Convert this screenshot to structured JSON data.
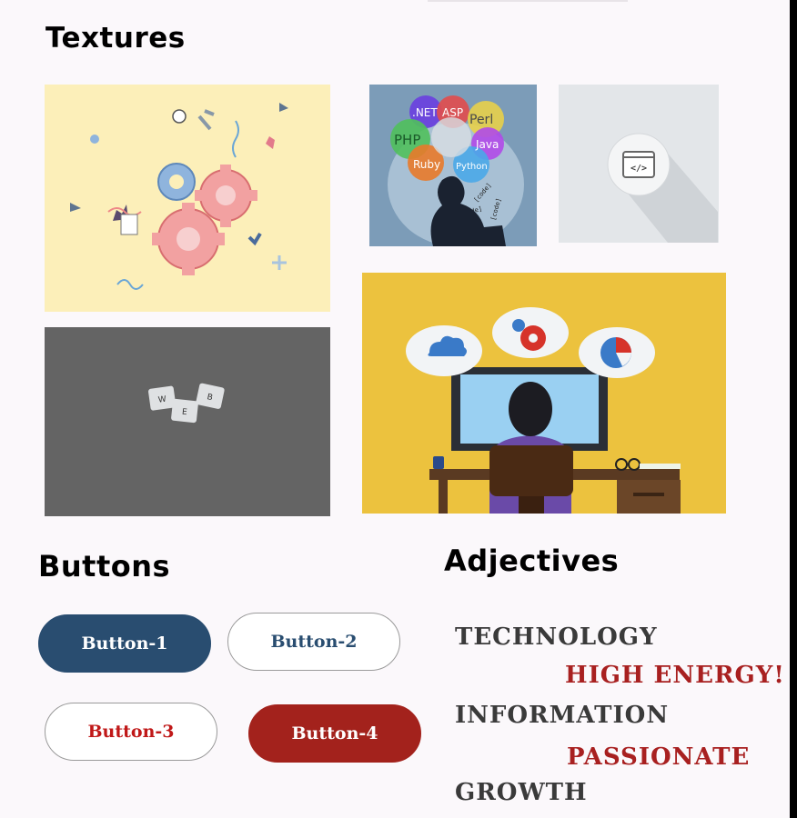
{
  "sections": {
    "textures_title": "Textures",
    "buttons_title": "Buttons",
    "adjectives_title": "Adjectives"
  },
  "textures": {
    "languages": [
      ".NET",
      "ASP",
      "Perl",
      "PHP",
      "Java",
      "Ruby",
      "Python"
    ],
    "code_tags": [
      "[code]",
      "[code]",
      "[code]"
    ],
    "code_icon_text": "</>",
    "keycaps": [
      "W",
      "E",
      "B"
    ]
  },
  "buttons": [
    {
      "label": "Button-1",
      "bg": "#294d70",
      "fg": "#ffffff",
      "border": "#294d70"
    },
    {
      "label": "Button-2",
      "bg": "#ffffff",
      "fg": "#294d70",
      "border": "#9a9a9a"
    },
    {
      "label": "Button-3",
      "bg": "#ffffff",
      "fg": "#c01818",
      "border": "#9a9a9a"
    },
    {
      "label": "Button-4",
      "bg": "#a3221c",
      "fg": "#ffffff",
      "border": "#a3221c"
    }
  ],
  "adjectives": [
    {
      "text": "TECHNOLOGY",
      "color": "#3a3a3a"
    },
    {
      "text": "HIGH ENERGY!",
      "color": "#a82020"
    },
    {
      "text": "INFORMATION",
      "color": "#3a3a3a"
    },
    {
      "text": "PASSIONATE",
      "color": "#a82020"
    },
    {
      "text": "GROWTH",
      "color": "#3a3a3a"
    }
  ]
}
